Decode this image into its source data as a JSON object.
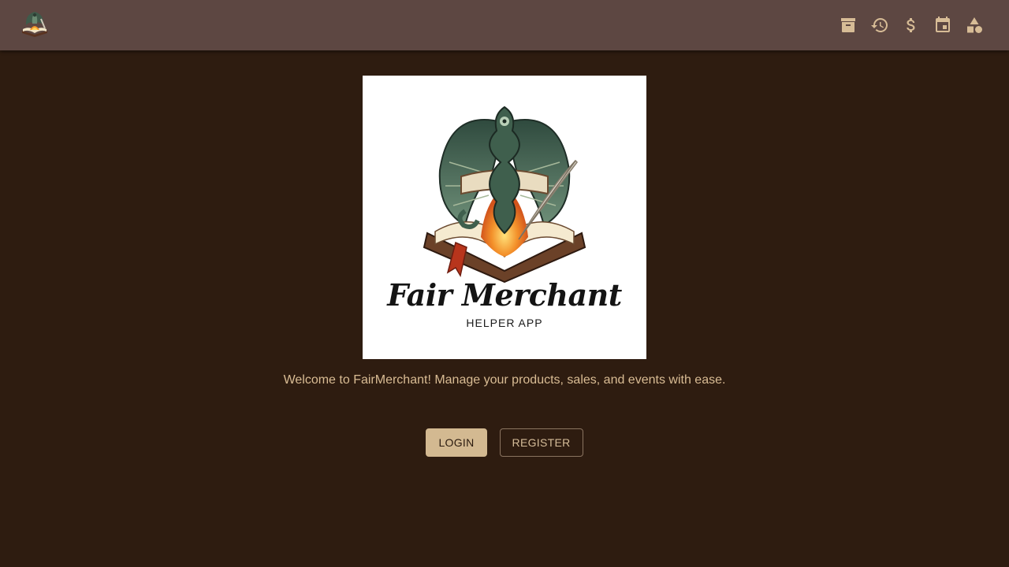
{
  "header": {
    "logo_icon": "dragon-book-logo-icon",
    "nav": [
      {
        "name": "inventory-archive-icon",
        "label": ""
      },
      {
        "name": "history-icon",
        "label": ""
      },
      {
        "name": "dollar-icon",
        "label": ""
      },
      {
        "name": "calendar-event-icon",
        "label": ""
      },
      {
        "name": "shapes-category-icon",
        "label": ""
      }
    ],
    "icon_color": "#d7bc96",
    "bar_color": "#5d4742"
  },
  "hero": {
    "title": "Fair Merchant",
    "subtitle": "HELPER APP"
  },
  "welcome_text": "Welcome to FairMerchant! Manage your products, sales, and events with ease.",
  "actions": {
    "login_label": "LOGIN",
    "register_label": "REGISTER"
  },
  "colors": {
    "background": "#2e1c10",
    "accent": "#d3b991"
  }
}
